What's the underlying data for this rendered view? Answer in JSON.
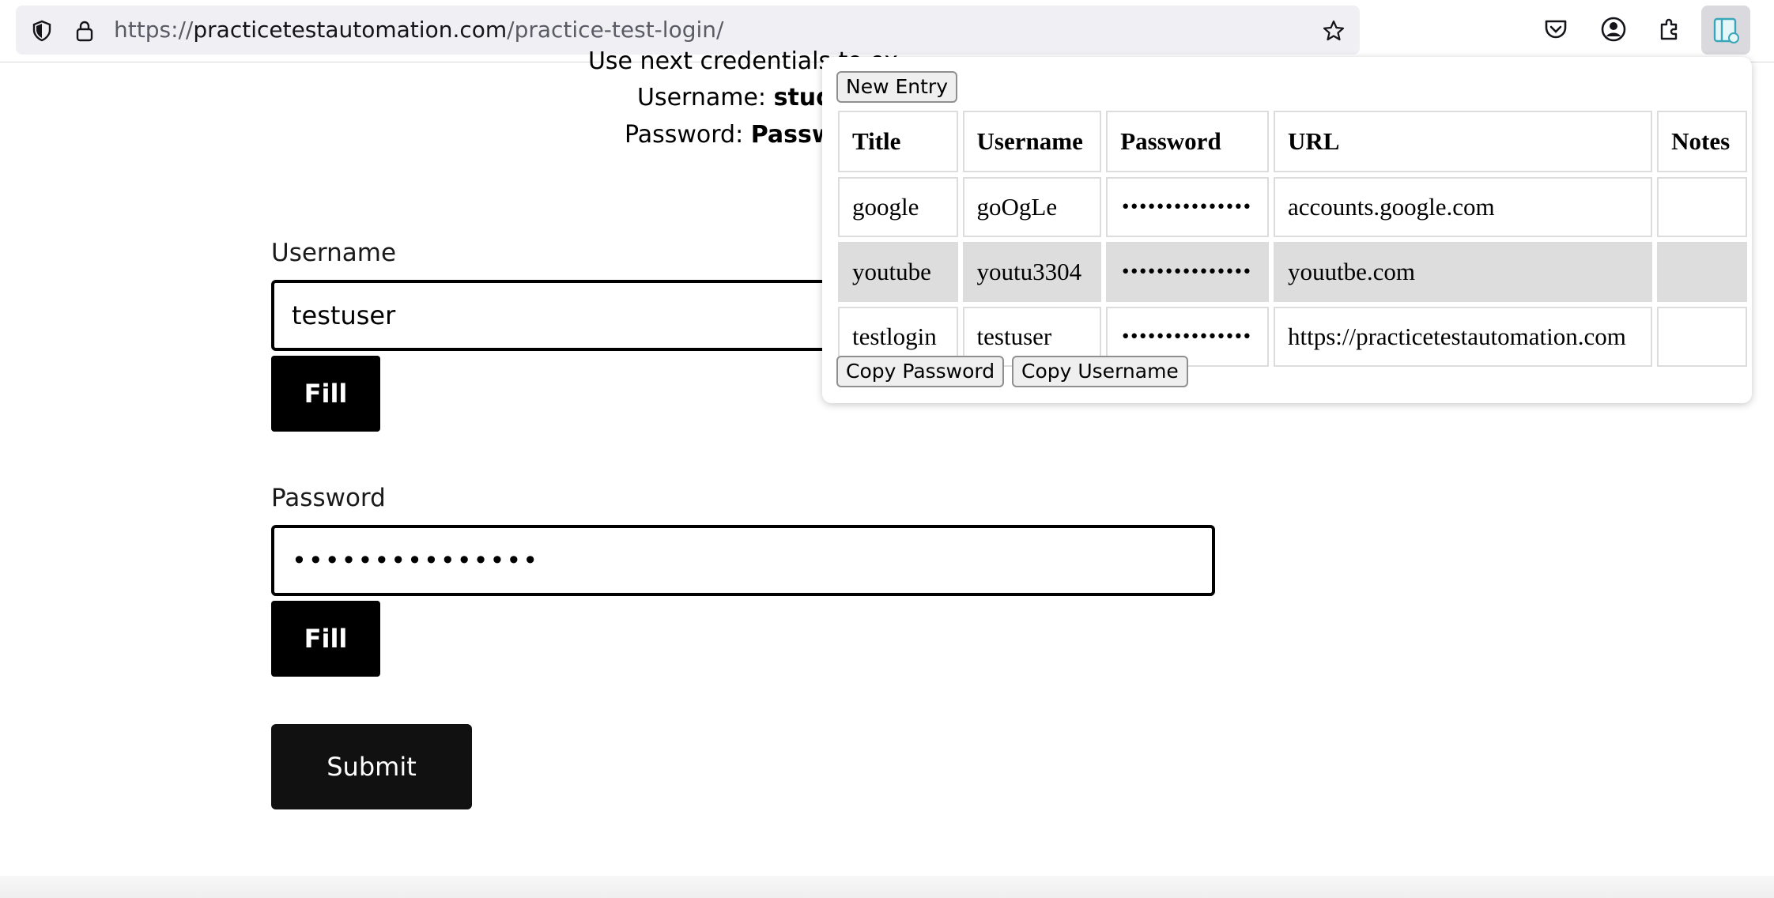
{
  "browser": {
    "url_prefix": "https://",
    "url_host": "practicetestautomation.com",
    "url_path": "/practice-test-login/"
  },
  "page": {
    "intro_line1": "Use next credentials to ex",
    "username_hint_label": "Username:",
    "username_hint_value": "stude",
    "password_hint_label": "Password:",
    "password_hint_value": "Passwor",
    "username_label": "Username",
    "username_value": "testuser",
    "password_label": "Password",
    "password_value": "•••••••••••••••",
    "fill_label": "Fill",
    "submit_label": "Submit"
  },
  "popup": {
    "new_entry_label": "New Entry",
    "columns": [
      "Title",
      "Username",
      "Password",
      "URL",
      "Notes"
    ],
    "rows": [
      {
        "title": "google",
        "username": "goOgLe",
        "password": "•••••••••••••••",
        "url": "accounts.google.com",
        "notes": ""
      },
      {
        "title": "youtube",
        "username": "youtu3304",
        "password": "•••••••••••••••",
        "url": "youutbe.com",
        "notes": ""
      },
      {
        "title": "testlogin",
        "username": "testuser",
        "password": "•••••••••••••••",
        "url": "https://practicetestautomation.com",
        "notes": ""
      }
    ],
    "selected_row": 1,
    "copy_password_label": "Copy Password",
    "copy_username_label": "Copy Username"
  }
}
